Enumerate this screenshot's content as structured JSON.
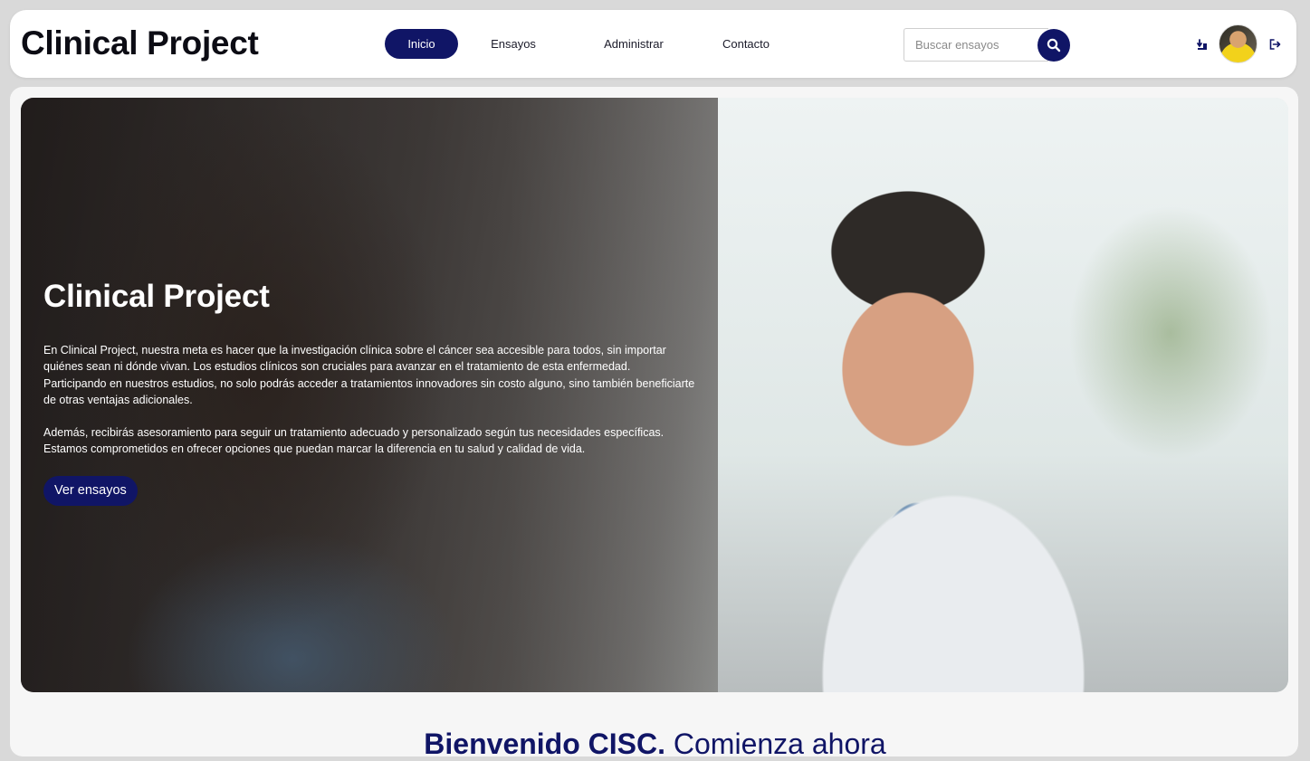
{
  "header": {
    "brand": "Clinical Project",
    "nav": [
      {
        "label": "Inicio",
        "active": true
      },
      {
        "label": "Ensayos",
        "active": false
      },
      {
        "label": "Administrar",
        "active": false
      },
      {
        "label": "Contacto",
        "active": false
      }
    ],
    "search": {
      "placeholder": "Buscar ensayos",
      "value": "",
      "icon": "search-icon"
    },
    "icons": [
      "upload-icon",
      "avatar",
      "logout-icon"
    ]
  },
  "hero": {
    "title": "Clinical Project",
    "paragraph1": "En Clinical Project, nuestra meta es hacer que la investigación clínica sobre el cáncer sea accesible para todos, sin importar quiénes sean ni dónde vivan. Los estudios clínicos son cruciales para avanzar en el tratamiento de esta enfermedad. Participando en nuestros estudios, no solo podrás acceder a tratamientos innovadores sin costo alguno, sino también beneficiarte de otras ventajas adicionales.",
    "paragraph2": "Además, recibirás asesoramiento para seguir un tratamiento adecuado y personalizado según tus necesidades específicas. Estamos comprometidos en ofrecer opciones que puedan marcar la diferencia en tu salud y calidad de vida.",
    "cta": "Ver ensayos"
  },
  "welcome": {
    "strong": "Bienvenido CISC.",
    "rest": " Comienza ahora"
  },
  "colors": {
    "accent": "#101566",
    "background": "#d9d9d9"
  }
}
